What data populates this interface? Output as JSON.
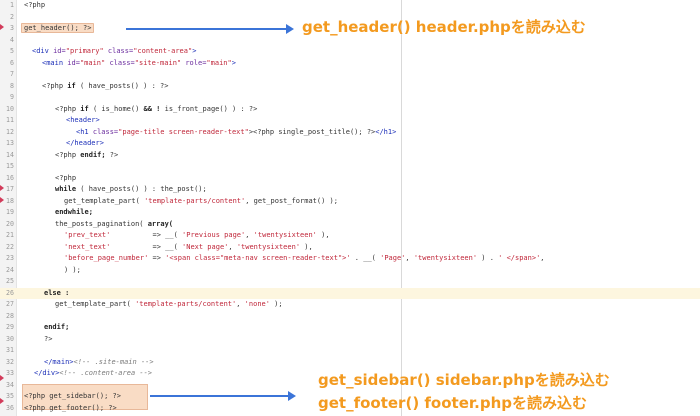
{
  "annotations": {
    "header_note": "get_header() header.phpを読み込む",
    "sidebar_note": "get_sidebar() sidebar.phpを読み込む",
    "footer_note": "get_footer() footer.phpを読み込む"
  },
  "colors": {
    "annotation": "#f39a1f",
    "arrow": "#3b74d8",
    "highlight_box": "#f9dcc5",
    "current_line": "#fdf6df"
  },
  "editor": {
    "line_numbers": [
      "1",
      "2",
      "3",
      "4",
      "5",
      "6",
      "7",
      "8",
      "9",
      "10",
      "11",
      "12",
      "13",
      "14",
      "15",
      "16",
      "17",
      "18",
      "19",
      "20",
      "21",
      "22",
      "23",
      "24",
      "25",
      "26",
      "27",
      "28",
      "29",
      "30",
      "31",
      "32",
      "33",
      "34",
      "35",
      "36"
    ],
    "l1": "<?php",
    "l3": "get_header(); ?>",
    "l5_a": "<div ",
    "l5_b": "id=",
    "l5_c": "\"primary\"",
    "l5_d": " class=",
    "l5_e": "\"content-area\"",
    "l5_f": ">",
    "l6_a": "<main ",
    "l6_b": "id=",
    "l6_c": "\"main\"",
    "l6_d": " class=",
    "l6_e": "\"site-main\"",
    "l6_f": " role=",
    "l6_g": "\"main\"",
    "l6_h": ">",
    "l8_a": "<?php ",
    "l8_b": "if",
    "l8_c": " ( have_posts() ) : ?>",
    "l10_a": "<?php ",
    "l10_b": "if",
    "l10_c": " ( is_home() ",
    "l10_d": "&& !",
    "l10_e": " is_front_page() ) : ?>",
    "l11": "<header>",
    "l12_a": "<h1 ",
    "l12_b": "class=",
    "l12_c": "\"page-title screen-reader-text\"",
    "l12_d": "><?php single_post_title(); ?>",
    "l12_e": "</h1>",
    "l13": "</header>",
    "l14_a": "<?php ",
    "l14_b": "endif;",
    "l14_c": " ?>",
    "l16": "<?php",
    "l17_a": "while",
    "l17_b": " ( have_posts() ) : the_post();",
    "l18_a": "get_template_part( ",
    "l18_b": "'template-parts/content'",
    "l18_c": ", get_post_format() );",
    "l19": "endwhile;",
    "l20_a": "the_posts_pagination( ",
    "l20_b": "array(",
    "l21_a": "'prev_text'",
    "l21_b": "          => __( ",
    "l21_c": "'Previous page'",
    "l21_d": ", ",
    "l21_e": "'twentysixteen'",
    "l21_f": " ),",
    "l22_a": "'next_text'",
    "l22_b": "          => __( ",
    "l22_c": "'Next page'",
    "l22_d": ", ",
    "l22_e": "'twentysixteen'",
    "l22_f": " ),",
    "l23_a": "'before_page_number'",
    "l23_b": " => ",
    "l23_c": "'<span class=\"meta-nav screen-reader-text\">'",
    "l23_d": " . __( ",
    "l23_e": "'Page'",
    "l23_f": ", ",
    "l23_g": "'twentysixteen'",
    "l23_h": " ) . ",
    "l23_i": "' </span>'",
    "l23_j": ",",
    "l24": ") );",
    "l26": "else :",
    "l27_a": "get_template_part( ",
    "l27_b": "'template-parts/content'",
    "l27_c": ", ",
    "l27_d": "'none'",
    "l27_e": " );",
    "l29": "endif;",
    "l30": "?>",
    "l32_a": "</main>",
    "l32_b": "<!-- .site-main -->",
    "l33_a": "</div>",
    "l33_b": "<!-- .content-area -->",
    "l35": "<?php get_sidebar(); ?>",
    "l36": "<?php get_footer(); ?>"
  }
}
